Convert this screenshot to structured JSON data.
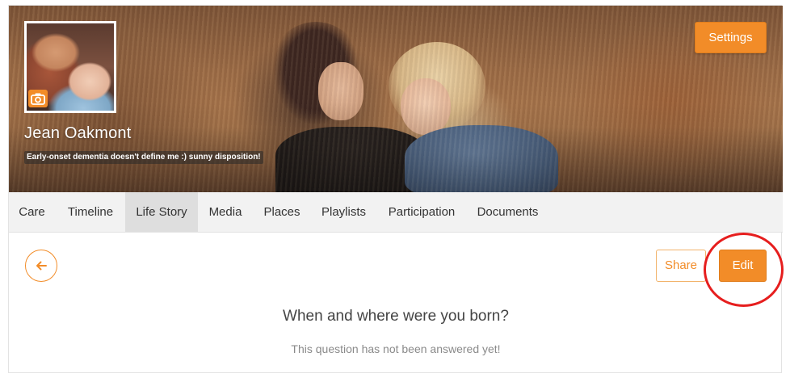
{
  "profile": {
    "name": "Jean Oakmont",
    "tagline": "Early-onset dementia doesn't define me :) sunny disposition!",
    "avatar_icon": "camera-icon"
  },
  "header": {
    "settings_label": "Settings"
  },
  "tabs": [
    {
      "label": "Care",
      "active": false
    },
    {
      "label": "Timeline",
      "active": false
    },
    {
      "label": "Life Story",
      "active": true
    },
    {
      "label": "Media",
      "active": false
    },
    {
      "label": "Places",
      "active": false
    },
    {
      "label": "Playlists",
      "active": false
    },
    {
      "label": "Participation",
      "active": false
    },
    {
      "label": "Documents",
      "active": false
    }
  ],
  "content": {
    "back_icon": "arrow-left-icon",
    "share_label": "Share",
    "edit_label": "Edit",
    "question": "When and where were you born?",
    "answer_placeholder": "This question has not been answered yet!"
  },
  "colors": {
    "accent": "#f28c28",
    "highlight": "#e61e1e"
  }
}
